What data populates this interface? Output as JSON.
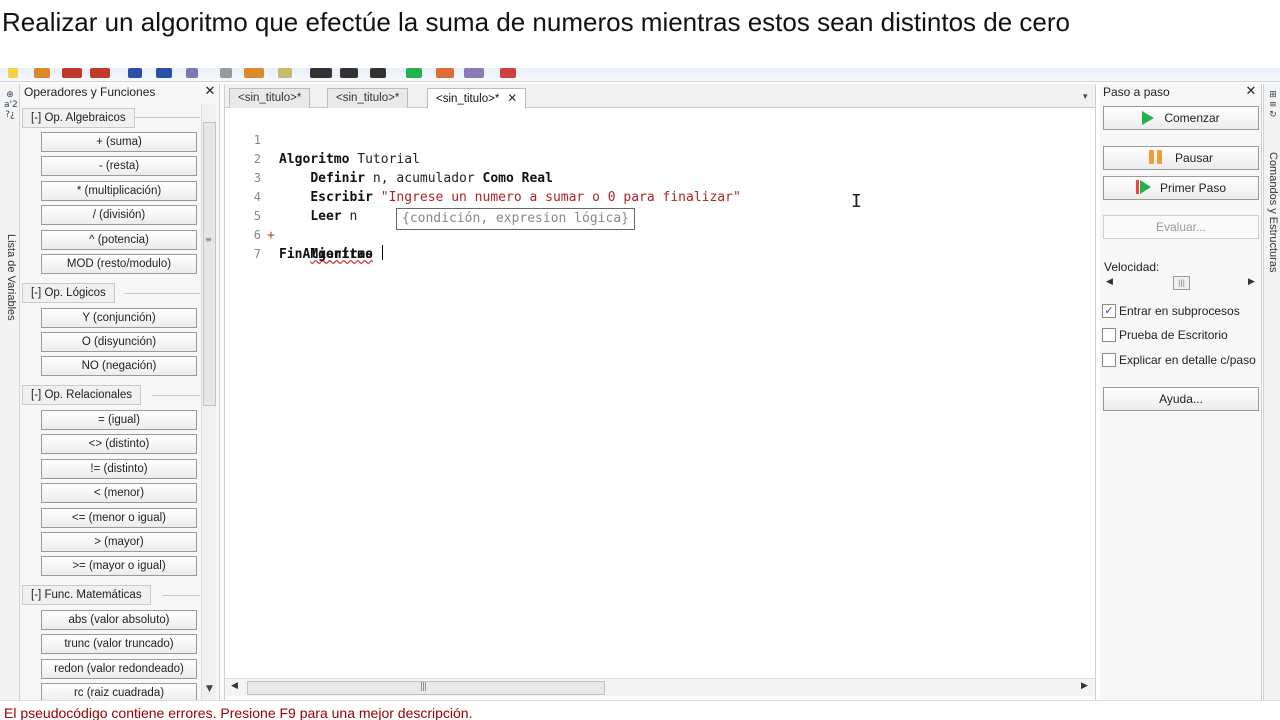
{
  "heading": "Realizar un algoritmo que efectúe la suma de numeros mientras estos sean distintos de cero",
  "left_strip": {
    "label": "Lista de Variables",
    "icon_glyphs": "⊕ a'2 ?¿"
  },
  "ops_panel": {
    "title": "Operadores y Funciones",
    "close": "✕",
    "sections": [
      {
        "toggle": "[-]",
        "title": "Op. Algebraicos",
        "items": [
          "+ (suma)",
          "- (resta)",
          "* (multiplicación)",
          "/ (división)",
          "^ (potencia)",
          "MOD (resto/modulo)"
        ]
      },
      {
        "toggle": "[-]",
        "title": "Op. Lógicos",
        "items": [
          "Y (conjunción)",
          "O (disyunción)",
          "NO (negación)"
        ]
      },
      {
        "toggle": "[-]",
        "title": "Op. Relacionales",
        "items": [
          "= (igual)",
          "<> (distinto)",
          "!= (distinto)",
          "< (menor)",
          "<= (menor o igual)",
          "> (mayor)",
          ">= (mayor o igual)"
        ]
      },
      {
        "toggle": "[-]",
        "title": "Func. Matemáticas",
        "items": [
          "abs (valor absoluto)",
          "trunc (valor truncado)",
          "redon (valor redondeado)",
          "rc (raiz cuadrada)"
        ]
      }
    ]
  },
  "editor": {
    "tabs": [
      {
        "label": "<sin_titulo>*",
        "active": false
      },
      {
        "label": "<sin_titulo>*",
        "active": false
      },
      {
        "label": "<sin_titulo>*",
        "active": true,
        "close": "✕"
      }
    ],
    "lines": [
      {
        "num": "1",
        "marker": "",
        "indent": "",
        "kw": "Algoritmo",
        "rest": " Tutorial"
      },
      {
        "num": "2",
        "marker": "",
        "indent": "    ",
        "kw": "Definir",
        "rest": " n, acumulador ",
        "kw2": "Como Real"
      },
      {
        "num": "3",
        "marker": "",
        "indent": "    ",
        "kw": "Escribir",
        "rest": " ",
        "str": "\"Ingrese un numero a sumar o 0 para finalizar\""
      },
      {
        "num": "4",
        "marker": "",
        "indent": "    ",
        "kw": "Leer",
        "rest": " n"
      },
      {
        "num": "5",
        "marker": "+",
        "indent": "    ",
        "kw": "Mientras",
        "rest": " "
      },
      {
        "num": "6",
        "marker": "",
        "indent": "",
        "kw": "FinAlgoritmo",
        "rest": ""
      },
      {
        "num": "7",
        "marker": "",
        "indent": "",
        "kw": "",
        "rest": ""
      }
    ],
    "calltip": "{condición, expresion lógica}",
    "mouse_cursor": "I"
  },
  "step_panel": {
    "title": "Paso a paso",
    "close": "✕",
    "buttons": {
      "start": "Comenzar",
      "pause": "Pausar",
      "first_step": "Primer Paso",
      "evaluate": "Evaluar...",
      "help": "Ayuda..."
    },
    "speed_label": "Velocidad:",
    "speed_level": 0.5,
    "checkboxes": [
      {
        "label": "Entrar en subprocesos",
        "checked": true
      },
      {
        "label": "Prueba de Escritorio",
        "checked": false
      },
      {
        "label": "Explicar en detalle c/paso",
        "checked": false
      }
    ]
  },
  "right_strip": {
    "label": "Comandos y Estructuras"
  },
  "status": "El pseudocódigo contiene errores. Presione F9 para una mejor descripción.",
  "colors": {
    "keyword": "#111111",
    "string": "#b22222",
    "status_error": "#a00000",
    "play": "#22b14c",
    "pause": "#f39c3a"
  }
}
